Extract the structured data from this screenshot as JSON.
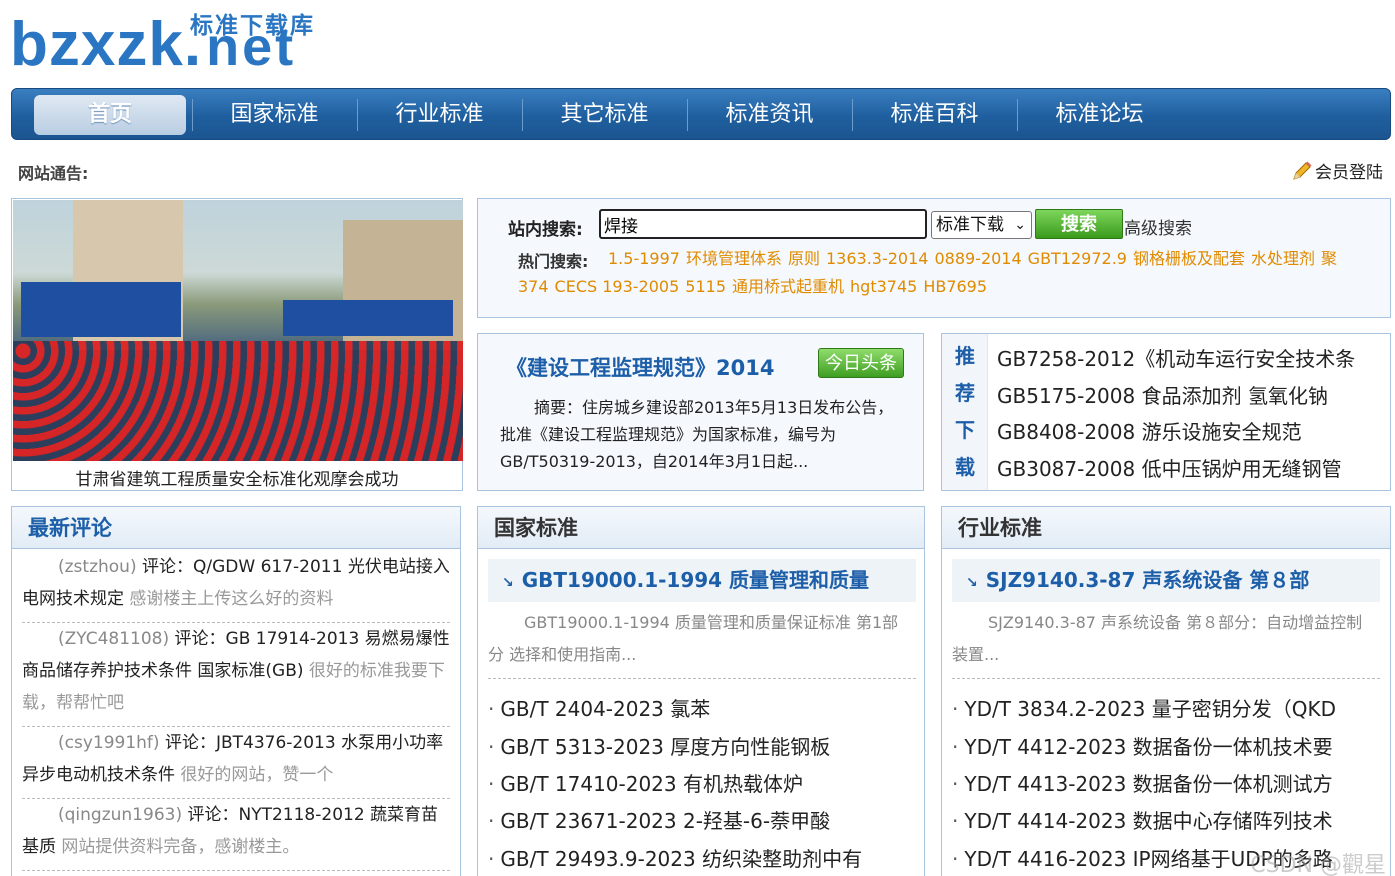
{
  "logo": {
    "main": "bzxzk",
    "dot": ".",
    "tld": "net",
    "subtitle": "标准下载库"
  },
  "nav": {
    "items": [
      "首页",
      "国家标准",
      "行业标准",
      "其它标准",
      "标准资讯",
      "标准百科",
      "标准论坛"
    ],
    "active_index": 0
  },
  "notice": {
    "label": "网站通告:"
  },
  "login": {
    "label": "会员登陆"
  },
  "featured": {
    "caption": "甘肃省建筑工程质量安全标准化观摩会成功"
  },
  "search": {
    "label": "站内搜索:",
    "value": "焊接",
    "category": "标准下载",
    "button": "搜索",
    "advanced": "高级搜索",
    "hot_label": "热门搜索:",
    "hot_terms": [
      "1.5-1997",
      "环境管理体系",
      "原则",
      "1363.3-2014",
      "0889-2014",
      "GBT12972.9",
      "钢格栅板及配套",
      "水处理剂",
      "聚",
      "374",
      "CECS 193-2005",
      "5115",
      "通用桥式起重机",
      "hgt3745",
      "HB7695"
    ]
  },
  "headline": {
    "title": "《建设工程监理规范》2014",
    "tag": "今日头条",
    "summary": "摘要：住房城乡建设部2013年5月13日发布公告，批准《建设工程监理规范》为国家标准，编号为GB/T50319-2013，自2014年3月1日起..."
  },
  "recommend": {
    "side_chars": [
      "推",
      "荐",
      "下",
      "载"
    ],
    "items": [
      "GB7258-2012《机动车运行安全技术条",
      "GB5175-2008 食品添加剂 氢氧化钠",
      "GB8408-2008 游乐设施安全规范",
      "GB3087-2008 低中压锅炉用无缝钢管"
    ]
  },
  "comments": {
    "title": "最新评论",
    "items": [
      {
        "user": "(zstzhou)",
        "text": "评论：Q/GDW 617-2011 光伏电站接入电网技术规定",
        "msg": "感谢楼主上传这么好的资料"
      },
      {
        "user": "(ZYC481108)",
        "text": "评论：GB 17914-2013 易燃易爆性商品储存养护技术条件 国家标准(GB)",
        "msg": "很好的标准我要下载，帮帮忙吧"
      },
      {
        "user": "(csy1991hf)",
        "text": "评论：JBT4376-2013 水泵用小功率异步电动机技术条件",
        "msg": "很好的网站，赞一个"
      },
      {
        "user": "(qingzun1963)",
        "text": "评论：NYT2118-2012 蔬菜育苗基质",
        "msg": "网站提供资料完备，感谢楼主。"
      }
    ]
  },
  "national": {
    "title": "国家标准",
    "featured_title": "GBT19000.1-1994 质量管理和质量",
    "featured_summary": "GBT19000.1-1994 质量管理和质量保证标准 第1部分 选择和使用指南...",
    "items": [
      "GB/T 2404-2023 氯苯",
      "GB/T 5313-2023 厚度方向性能钢板",
      "GB/T 17410-2023 有机热载体炉",
      "GB/T 23671-2023 2-羟基-6-萘甲酸",
      "GB/T 29493.9-2023 纺织染整助剂中有"
    ]
  },
  "industry": {
    "title": "行业标准",
    "featured_title": "SJZ9140.3-87 声系统设备 第８部",
    "featured_summary": "SJZ9140.3-87 声系统设备 第８部分：自动增益控制装置...",
    "items": [
      "YD/T 3834.2-2023 量子密钥分发（QKD",
      "YD/T 4412-2023 数据备份一体机技术要",
      "YD/T 4413-2023 数据备份一体机测试方",
      "YD/T 4414-2023 数据中心存储阵列技术",
      "YD/T 4416-2023 IP网络基于UDP的多路"
    ]
  },
  "watermark": "CSDN @觀星",
  "colors": {
    "nav": "#1f5f9f",
    "accent_blue": "#1d5ea8",
    "hot_orange": "#e08a00",
    "green_button": "#3a9a1c"
  }
}
